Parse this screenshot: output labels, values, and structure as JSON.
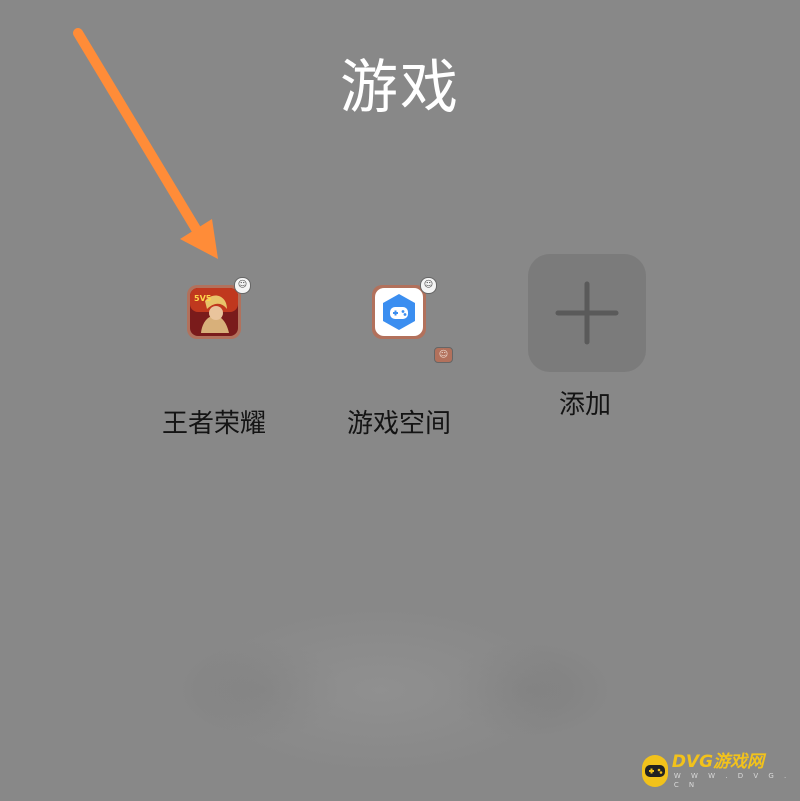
{
  "folder": {
    "title": "游戏"
  },
  "apps": [
    {
      "label": "王者荣耀",
      "icon": "honor-of-kings-icon"
    },
    {
      "label": "游戏空间",
      "icon": "game-space-icon"
    },
    {
      "label": "添加",
      "icon": "plus-icon"
    }
  ],
  "annotation": {
    "arrow_color": "#FF8C38"
  },
  "watermark": {
    "brand": "DVG游戏网",
    "domain": "W W W . D V G . C N"
  }
}
